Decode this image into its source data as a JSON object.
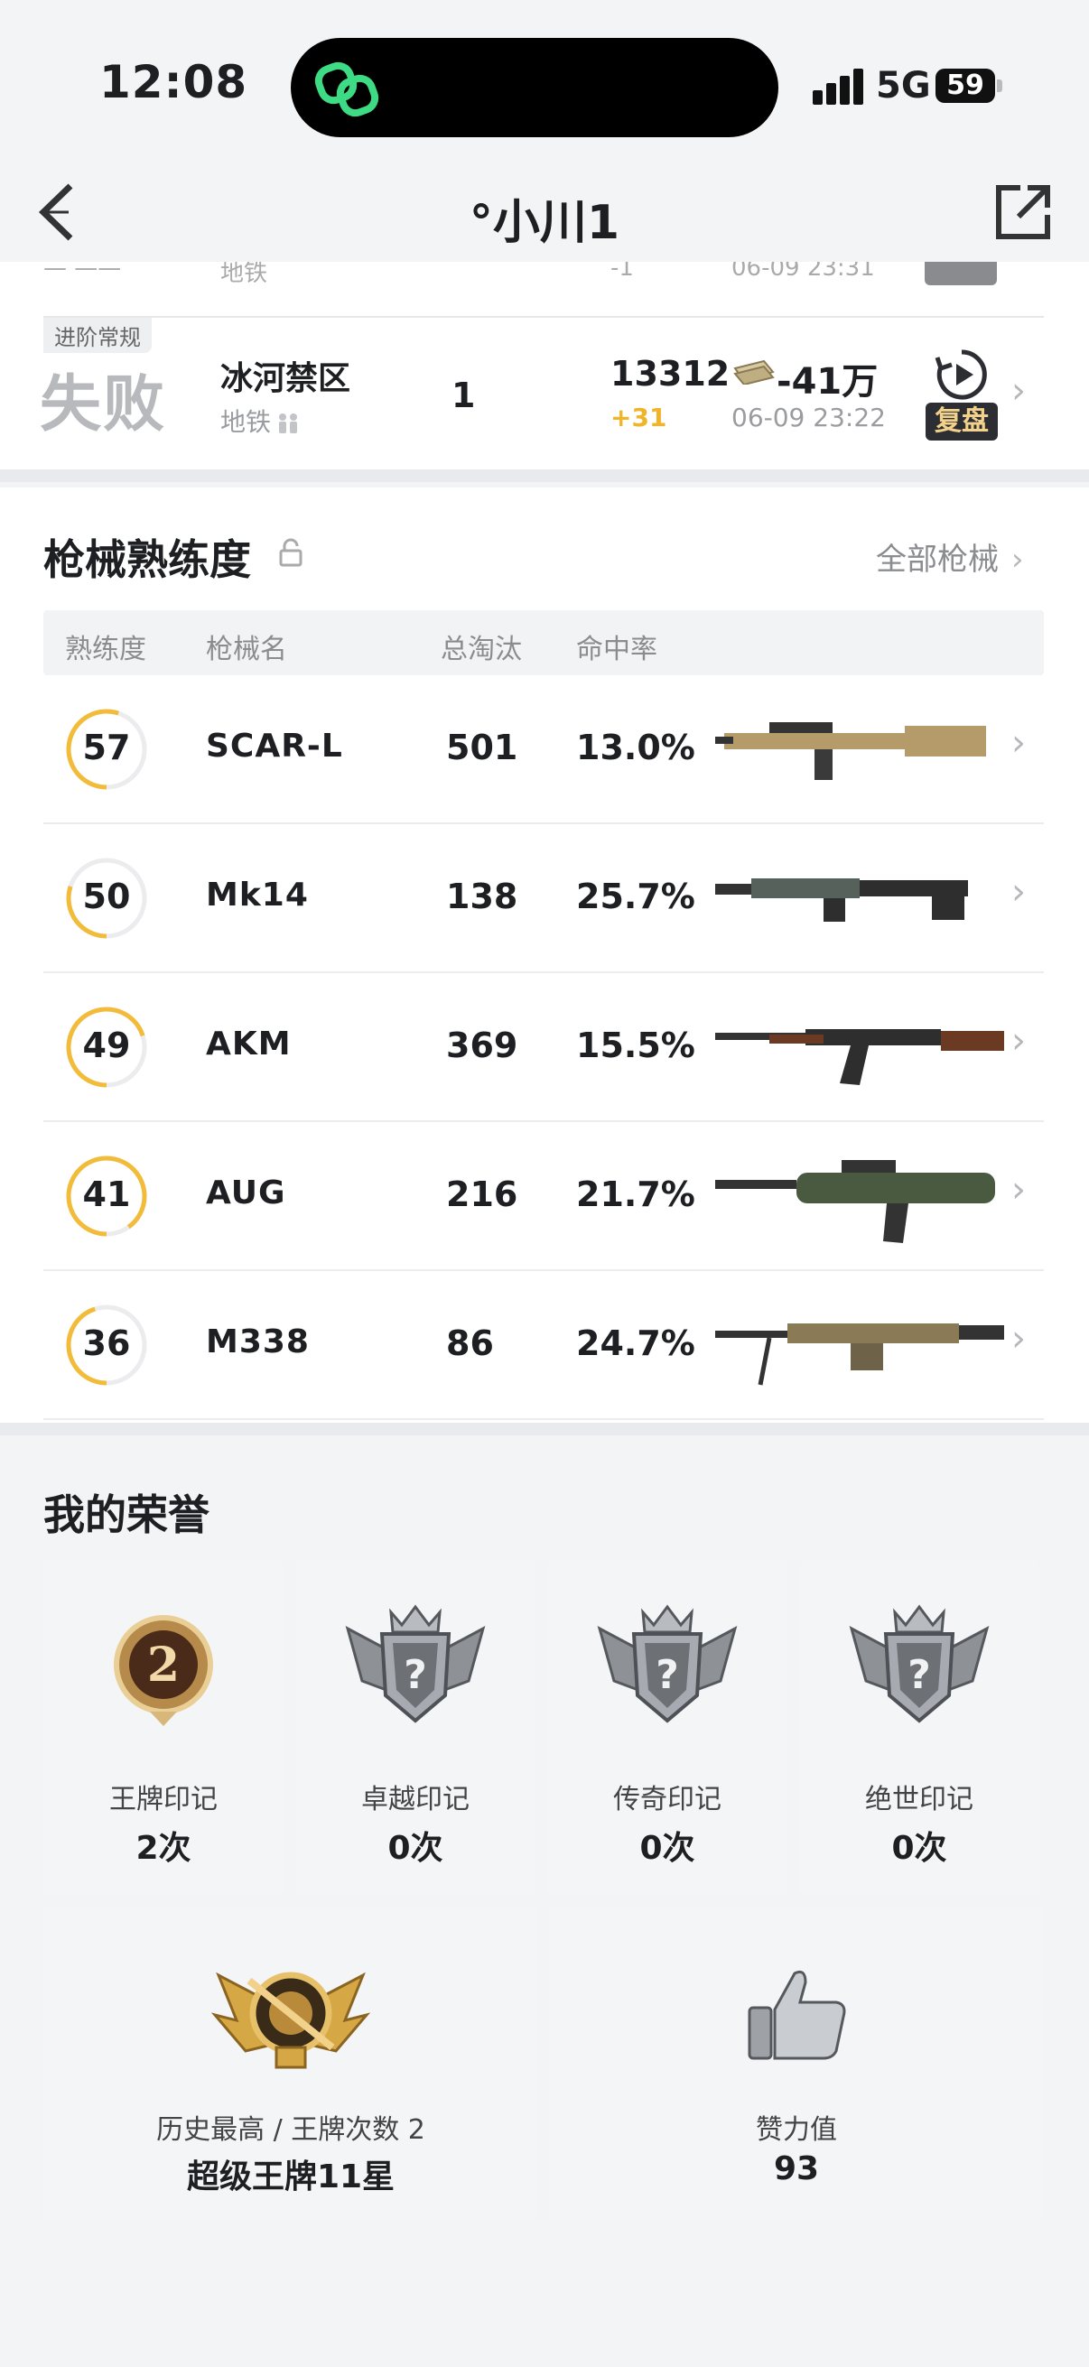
{
  "status_bar": {
    "time": "12:08",
    "network": "5G",
    "battery": "59"
  },
  "header": {
    "title": "°小川1",
    "back_icon": "chevron-left-icon",
    "share_icon": "share-out-icon"
  },
  "match": {
    "mode_tag": "进阶常规",
    "result": "失败",
    "map_name": "冰河禁区",
    "map_sub": "地铁",
    "rank": "1",
    "score": "13312",
    "score_delta": "+31",
    "cash": "-41万",
    "time": "06-09 23:22",
    "replay_label": "复盘"
  },
  "weapons_section": {
    "title": "枪械熟练度",
    "all_link": "全部枪械",
    "headers": [
      "熟练度",
      "枪械名",
      "总淘汰",
      "命中率"
    ],
    "colors": {
      "ring": "#f2bc3a",
      "ring_track": "#ececee"
    },
    "rows": [
      {
        "level": "57",
        "progress": 0.55,
        "name": "SCAR-L",
        "kills": "501",
        "accuracy": "13.0%"
      },
      {
        "level": "50",
        "progress": 0.3,
        "name": "Mk14",
        "kills": "138",
        "accuracy": "25.7%"
      },
      {
        "level": "49",
        "progress": 0.7,
        "name": "AKM",
        "kills": "369",
        "accuracy": "15.5%"
      },
      {
        "level": "41",
        "progress": 0.9,
        "name": "AUG",
        "kills": "216",
        "accuracy": "21.7%"
      },
      {
        "level": "36",
        "progress": 0.45,
        "name": "M338",
        "kills": "86",
        "accuracy": "24.7%"
      }
    ]
  },
  "honors_section": {
    "title": "我的荣誉",
    "marks": [
      {
        "label": "王牌印记",
        "count": "2次",
        "badge_number": "2"
      },
      {
        "label": "卓越印记",
        "count": "0次",
        "badge_number": "?"
      },
      {
        "label": "传奇印记",
        "count": "0次",
        "badge_number": "?"
      },
      {
        "label": "绝世印记",
        "count": "0次",
        "badge_number": "?"
      }
    ],
    "highest": {
      "label": "历史最高 / 王牌次数 2",
      "value": "超级王牌11星"
    },
    "likes": {
      "label": "赞力值",
      "value": "93"
    }
  }
}
